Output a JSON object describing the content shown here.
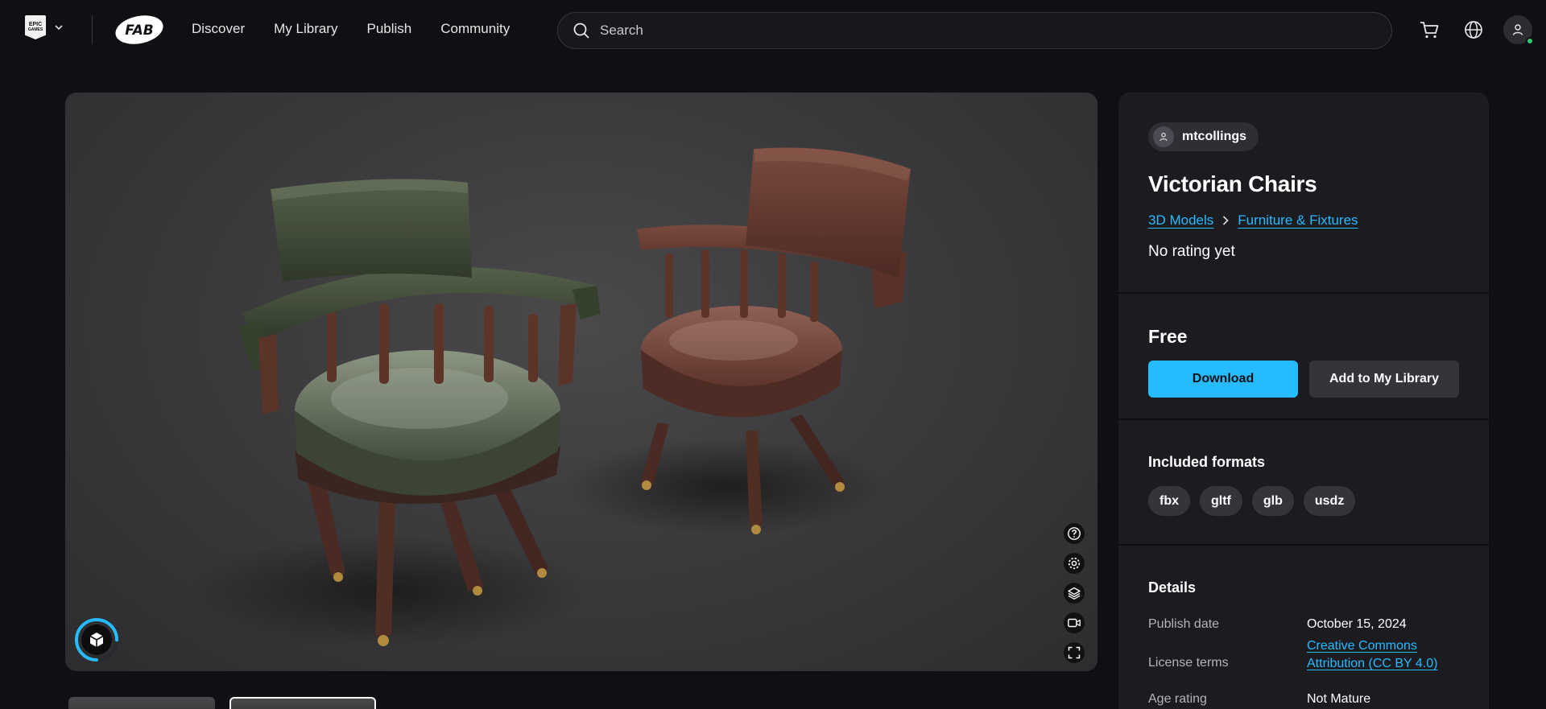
{
  "header": {
    "epic_logo_lines": [
      "EPIC",
      "GAMES"
    ],
    "fab_logo_text": "FAB",
    "nav": [
      {
        "label": "Discover"
      },
      {
        "label": "My Library"
      },
      {
        "label": "Publish"
      },
      {
        "label": "Community"
      }
    ],
    "search": {
      "placeholder": "Search",
      "value": ""
    },
    "icons": [
      "cart-icon",
      "globe-icon",
      "user-icon"
    ]
  },
  "viewer": {
    "tools": [
      "help-icon",
      "settings-icon",
      "layers-icon",
      "camera-icon",
      "fullscreen-icon"
    ],
    "loader_icon": "cube-icon",
    "loader_progress": 0.75,
    "thumbnail_count": 2,
    "selected_thumbnail": 2
  },
  "product": {
    "author": "mtcollings",
    "title": "Victorian Chairs",
    "breadcrumbs": [
      "3D Models",
      "Furniture & Fixtures"
    ],
    "rating_text": "No rating yet",
    "price": "Free",
    "download_label": "Download",
    "add_library_label": "Add to My Library",
    "formats_heading": "Included formats",
    "formats": [
      "fbx",
      "gltf",
      "glb",
      "usdz"
    ],
    "details_heading": "Details",
    "details": {
      "publish_label": "Publish date",
      "publish_value": "October 15, 2024",
      "license_label": "License terms",
      "license_value_line1": "Creative Commons",
      "license_value_line2": "Attribution (CC BY 4.0)",
      "age_label": "Age rating",
      "age_value": "Not Mature"
    }
  },
  "colors": {
    "background": "#101014",
    "panel": "#1b1b20",
    "accent": "#26bbff",
    "online": "#2ecc71"
  }
}
